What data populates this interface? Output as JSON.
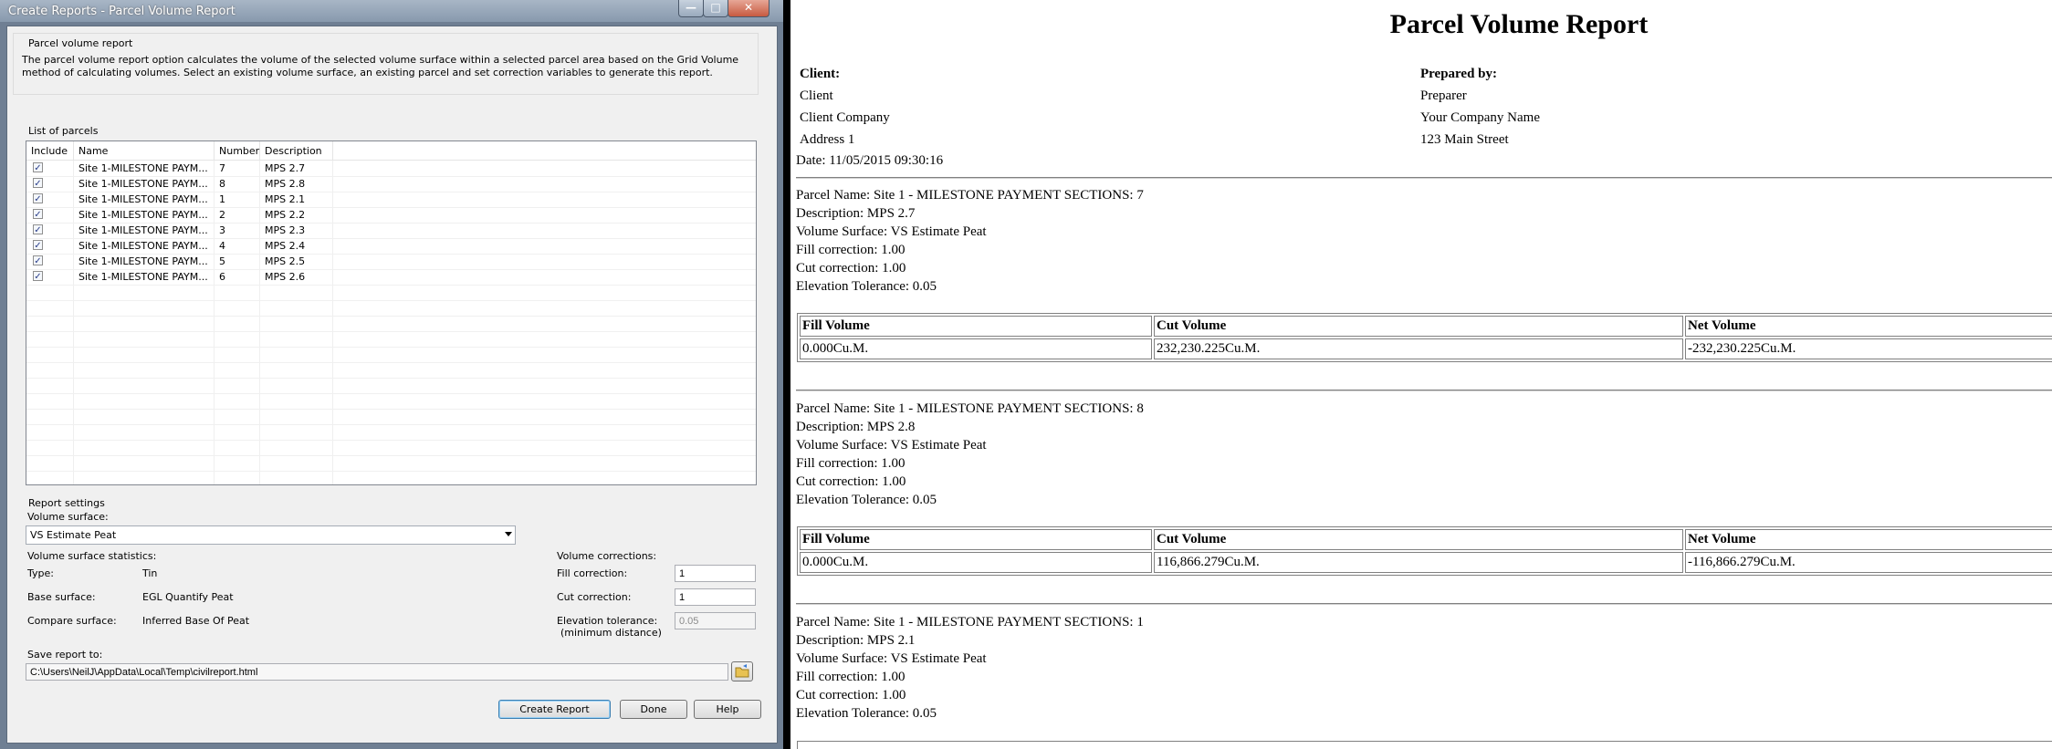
{
  "dialog": {
    "title": "Create Reports - Parcel Volume Report",
    "intro": {
      "group_label": "Parcel volume report",
      "text": "The parcel volume report option calculates the volume of the selected volume surface within a selected parcel area based on the Grid Volume method of calculating volumes. Select an existing volume surface, an existing parcel and set correction variables to generate this report."
    },
    "parcels": {
      "group_label": "List of parcels",
      "headers": [
        "Include",
        "Name",
        "Number",
        "Description"
      ],
      "rows": [
        {
          "name": "Site 1-MILESTONE PAYM...",
          "number": "7",
          "description": "MPS 2.7"
        },
        {
          "name": "Site 1-MILESTONE PAYM...",
          "number": "8",
          "description": "MPS 2.8"
        },
        {
          "name": "Site 1-MILESTONE PAYM...",
          "number": "1",
          "description": "MPS 2.1"
        },
        {
          "name": "Site 1-MILESTONE PAYM...",
          "number": "2",
          "description": "MPS 2.2"
        },
        {
          "name": "Site 1-MILESTONE PAYM...",
          "number": "3",
          "description": "MPS 2.3"
        },
        {
          "name": "Site 1-MILESTONE PAYM...",
          "number": "4",
          "description": "MPS 2.4"
        },
        {
          "name": "Site 1-MILESTONE PAYM...",
          "number": "5",
          "description": "MPS 2.5"
        },
        {
          "name": "Site 1-MILESTONE PAYM...",
          "number": "6",
          "description": "MPS 2.6"
        }
      ],
      "check_glyph": "✓"
    },
    "settings": {
      "group_label": "Report settings",
      "volume_surface_label": "Volume surface:",
      "volume_surface_value": "VS Estimate Peat",
      "stats_label": "Volume surface statistics:",
      "type_label": "Type:",
      "type_value": "Tin",
      "base_label": "Base surface:",
      "base_value": "EGL Quantify Peat",
      "compare_label": "Compare surface:",
      "compare_value": "Inferred Base Of Peat",
      "corrections_label": "Volume corrections:",
      "fill_label": "Fill correction:",
      "fill_value": "1",
      "cut_label": "Cut correction:",
      "cut_value": "1",
      "elev_label": "Elevation  tolerance:",
      "elev_sub": "(minimum distance)",
      "elev_value": "0.05",
      "save_label": "Save report to:",
      "save_path": "C:\\Users\\NeilJ\\AppData\\Local\\Temp\\civilreport.html"
    },
    "buttons": {
      "create": "Create Report",
      "done": "Done",
      "help": "Help"
    },
    "window_buttons": {
      "minimize": "—",
      "maximize": "□",
      "close": "✕"
    }
  },
  "report": {
    "title": "Parcel Volume Report",
    "client_label": "Client:",
    "client_lines": [
      "Client",
      "Client Company",
      "Address 1"
    ],
    "prepared_label": "Prepared by:",
    "prepared_lines": [
      "Preparer",
      "Your Company Name",
      "123 Main Street"
    ],
    "date": "Date: 11/05/2015 09:30:16",
    "table_headers": [
      "Fill Volume",
      "Cut Volume",
      "Net Volume"
    ],
    "parcels": [
      {
        "name": "Parcel Name: Site 1 - MILESTONE PAYMENT SECTIONS: 7",
        "description": "Description: MPS 2.7",
        "surface": "Volume Surface: VS Estimate Peat",
        "fill_corr": "Fill correction: 1.00",
        "cut_corr": "Cut correction: 1.00",
        "elev": "Elevation Tolerance: 0.05",
        "fill_volume": "0.000Cu.M.",
        "cut_volume": "232,230.225Cu.M.",
        "net_volume": "-232,230.225Cu.M."
      },
      {
        "name": "Parcel Name: Site 1 - MILESTONE PAYMENT SECTIONS: 8",
        "description": "Description: MPS 2.8",
        "surface": "Volume Surface: VS Estimate Peat",
        "fill_corr": "Fill correction: 1.00",
        "cut_corr": "Cut correction: 1.00",
        "elev": "Elevation Tolerance: 0.05",
        "fill_volume": "0.000Cu.M.",
        "cut_volume": "116,866.279Cu.M.",
        "net_volume": "-116,866.279Cu.M."
      },
      {
        "name": "Parcel Name: Site 1 - MILESTONE PAYMENT SECTIONS: 1",
        "description": "Description: MPS 2.1",
        "surface": "Volume Surface: VS Estimate Peat",
        "fill_corr": "Fill correction: 1.00",
        "cut_corr": "Cut correction: 1.00",
        "elev": "Elevation Tolerance: 0.05"
      }
    ]
  }
}
